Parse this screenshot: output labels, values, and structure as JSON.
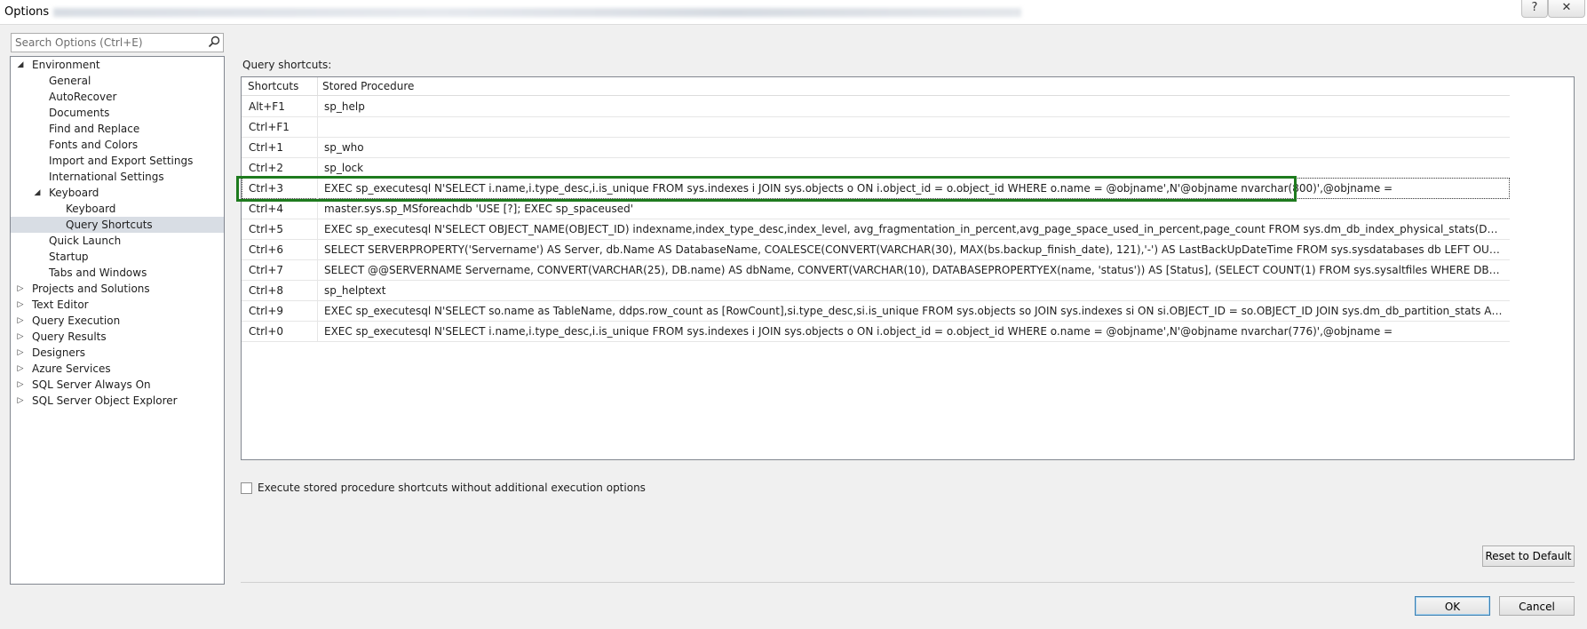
{
  "window": {
    "title": "Options"
  },
  "search": {
    "placeholder": "Search Options (Ctrl+E)"
  },
  "tree": {
    "items": [
      {
        "label": "Environment"
      },
      {
        "label": "General"
      },
      {
        "label": "AutoRecover"
      },
      {
        "label": "Documents"
      },
      {
        "label": "Find and Replace"
      },
      {
        "label": "Fonts and Colors"
      },
      {
        "label": "Import and Export Settings"
      },
      {
        "label": "International Settings"
      },
      {
        "label": "Keyboard"
      },
      {
        "label": "Keyboard"
      },
      {
        "label": "Query Shortcuts"
      },
      {
        "label": "Quick Launch"
      },
      {
        "label": "Startup"
      },
      {
        "label": "Tabs and Windows"
      },
      {
        "label": "Projects and Solutions"
      },
      {
        "label": "Text Editor"
      },
      {
        "label": "Query Execution"
      },
      {
        "label": "Query Results"
      },
      {
        "label": "Designers"
      },
      {
        "label": "Azure Services"
      },
      {
        "label": "SQL Server Always On"
      },
      {
        "label": "SQL Server Object Explorer"
      }
    ]
  },
  "main": {
    "section_label": "Query shortcuts:",
    "columns": {
      "shortcut": "Shortcuts",
      "procedure": "Stored Procedure"
    },
    "rows": [
      {
        "key": "Alt+F1",
        "value": "sp_help"
      },
      {
        "key": "Ctrl+F1",
        "value": ""
      },
      {
        "key": "Ctrl+1",
        "value": "sp_who"
      },
      {
        "key": "Ctrl+2",
        "value": "sp_lock"
      },
      {
        "key": "Ctrl+3",
        "value": "EXEC sp_executesql N'SELECT i.name,i.type_desc,i.is_unique FROM sys.indexes i JOIN sys.objects o ON i.object_id = o.object_id WHERE o.name = @objname',N'@objname nvarchar(800)',@objname ="
      },
      {
        "key": "Ctrl+4",
        "value": "master.sys.sp_MSforeachdb 'USE [?]; EXEC sp_spaceused'"
      },
      {
        "key": "Ctrl+5",
        "value": "EXEC sp_executesql N'SELECT OBJECT_NAME(OBJECT_ID) indexname,index_type_desc,index_level, avg_fragmentation_in_percent,avg_page_space_used_in_percent,page_count FROM sys.dm_db_index_physical_stats(DB_ID(), OBJECT_ID(@objname), N..."
      },
      {
        "key": "Ctrl+6",
        "value": "SELECT SERVERPROPERTY('Servername') AS Server, db.Name AS DatabaseName, COALESCE(CONVERT(VARCHAR(30), MAX(bs.backup_finish_date), 121),'-') AS LastBackUpDateTime FROM sys.sysdatabases db LEFT OUTER JOIN msdb.dbo.backupset b..."
      },
      {
        "key": "Ctrl+7",
        "value": "SELECT @@SERVERNAME Servername, CONVERT(VARCHAR(25), DB.name) AS dbName, CONVERT(VARCHAR(10), DATABASEPROPERTYEX(name, 'status')) AS [Status], (SELECT COUNT(1) FROM sys.sysaltfiles WHERE DB_NAME(dbid) = DB.name AND..."
      },
      {
        "key": "Ctrl+8",
        "value": "sp_helptext"
      },
      {
        "key": "Ctrl+9",
        "value": "EXEC sp_executesql N'SELECT so.name as TableName, ddps.row_count as [RowCount],si.type_desc,si.is_unique FROM sys.objects so JOIN sys.indexes si ON si.OBJECT_ID = so.OBJECT_ID JOIN sys.dm_db_partition_stats AS ddps ON si.OBJECT_ID = ddps..."
      },
      {
        "key": "Ctrl+0",
        "value": "EXEC sp_executesql N'SELECT i.name,i.type_desc,i.is_unique FROM sys.indexes i JOIN sys.objects o ON i.object_id = o.object_id WHERE o.name = @objname',N'@objname nvarchar(776)',@objname ="
      }
    ],
    "checkbox_label": "Execute stored procedure shortcuts without additional execution options"
  },
  "buttons": {
    "reset": "Reset to Default",
    "ok": "OK",
    "cancel": "Cancel",
    "help": "?",
    "close": "✕"
  },
  "colors": {
    "highlight_border": "#1e7b1e",
    "selected_item": "#d8dde4"
  }
}
